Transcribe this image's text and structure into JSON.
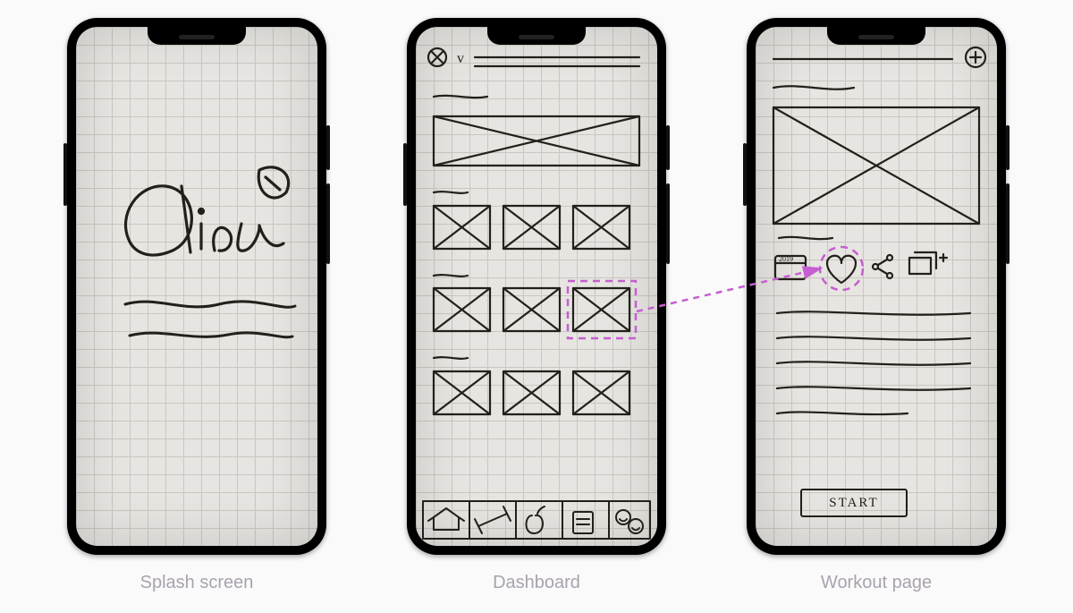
{
  "captions": {
    "splash": "Splash screen",
    "dashboard": "Dashboard",
    "workout": "Workout page"
  },
  "splash": {
    "logo_text": "Olive"
  },
  "dashboard": {
    "header_icon": "close",
    "header_dropdown": "v",
    "sections": 3,
    "cards_per_section": 3,
    "bottom_nav": [
      "home",
      "workout",
      "nutrition",
      "journal",
      "community"
    ]
  },
  "workout": {
    "header_action": "add",
    "actions": [
      "calendar",
      "favorite",
      "share",
      "add-to-queue"
    ],
    "start_label": "START",
    "highlight_action": "favorite"
  },
  "flow": {
    "from": "dashboard.section2.card3",
    "to": "workout.favorite"
  }
}
